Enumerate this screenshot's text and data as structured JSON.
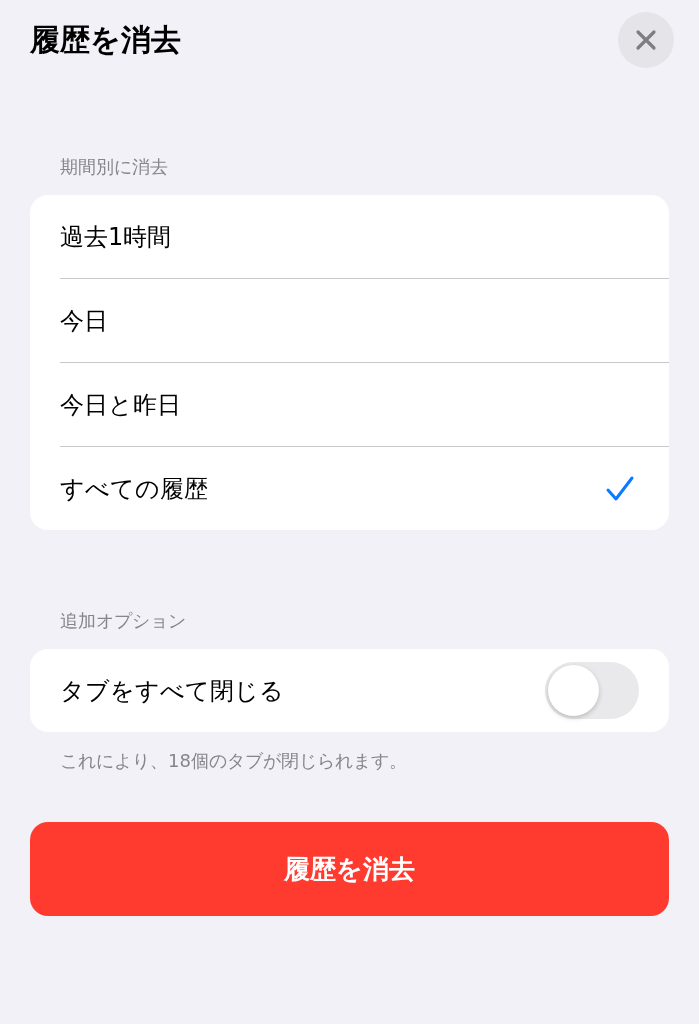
{
  "title": "履歴を消去",
  "sections": [
    {
      "header": "期間別に消去",
      "kind": "choices",
      "items": [
        {
          "label": "過去1時間",
          "selected": false
        },
        {
          "label": "今日",
          "selected": false
        },
        {
          "label": "今日と昨日",
          "selected": false
        },
        {
          "label": "すべての履歴",
          "selected": true
        }
      ]
    },
    {
      "header": "追加オプション",
      "kind": "toggles",
      "items": [
        {
          "label": "タブをすべて閉じる",
          "on": false
        }
      ],
      "footer": "これにより、18個のタブが閉じられます。"
    }
  ],
  "action_button": {
    "label": "履歴を消去"
  }
}
